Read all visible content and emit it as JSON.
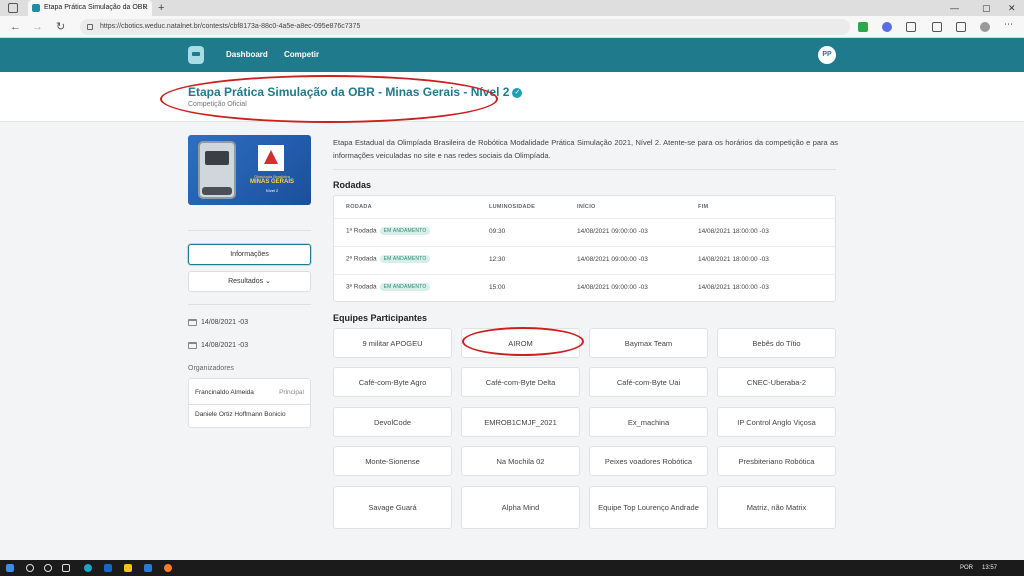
{
  "browser": {
    "tab_title": "Etapa Prática Simulação da OBR",
    "tab_close": "×",
    "new_tab": "+",
    "url": "https://cbotics.weduc.natalnet.br/contests/cbf8173a-88c0-4a5e-a8ec-095e876c7375",
    "back": "←",
    "forward": "→",
    "reload": "↻",
    "minimize": "—",
    "maximize": "▢",
    "close": "✕"
  },
  "appbar": {
    "nav": [
      "Dashboard",
      "Competir"
    ],
    "avatar_initials": "PP"
  },
  "header": {
    "title": "Etapa Prática Simulação da OBR - Minas Gerais - Nível 2",
    "verified_mark": "✓",
    "subtitle": "Competição Oficial"
  },
  "banner": {
    "small_text": "Olimpíada Brasileira",
    "big_text": "MINAS GERAIS",
    "level_text": "Nível 2"
  },
  "sidebar": {
    "info_button": "Informações",
    "results_button": "Resultados",
    "results_chevron": "⌄",
    "dates": [
      "14/08/2021 -03",
      "14/08/2021 -03"
    ],
    "organizers_title": "Organizadores",
    "organizers": [
      {
        "name": "Francinaldo Almeida",
        "role": "Principal"
      },
      {
        "name": "Daniele Ortiz Hoffmann Bonicio",
        "role": ""
      }
    ]
  },
  "main": {
    "description": "Etapa Estadual da Olimpíada Brasileira de Robótica Modalidade Prática Simulação 2021, Nível 2. Atente-se para os horários da competição e para as informações veiculadas no site e nas redes sociais da Olimpíada.",
    "rounds_title": "Rodadas",
    "rounds_headers": [
      "RODADA",
      "LUMINOSIDADE",
      "INÍCIO",
      "FIM"
    ],
    "rounds": [
      {
        "name": "1ª Rodada",
        "status": "EM ANDAMENTO",
        "luminosity": "09:30",
        "start": "14/08/2021 09:00:00 -03",
        "end": "14/08/2021 18:00:00 -03"
      },
      {
        "name": "2ª Rodada",
        "status": "EM ANDAMENTO",
        "luminosity": "12:30",
        "start": "14/08/2021 09:00:00 -03",
        "end": "14/08/2021 18:00:00 -03"
      },
      {
        "name": "3ª Rodada",
        "status": "EM ANDAMENTO",
        "luminosity": "15:00",
        "start": "14/08/2021 09:00:00 -03",
        "end": "14/08/2021 18:00:00 -03"
      }
    ],
    "teams_title": "Equipes Participantes",
    "teams": [
      "9 militar APOGEU",
      "AIROM",
      "Baymax Team",
      "Bebês do Títio",
      "Café-com-Byte Agro",
      "Café-com-Byte Delta",
      "Café-com-Byte Uai",
      "CNEC-Uberaba-2",
      "DevolCode",
      "EMROB1CMJF_2021",
      "Ex_machina",
      "IP Control Anglo Viçosa",
      "Monte-Sionense",
      "Na Mochila 02",
      "Peixes voadores Robótica",
      "Presbiteriano Robótica",
      "Savage Guará",
      "Alpha Mind",
      "Equipe Top Lourenço Andrade",
      "Matriz, não Matrix"
    ]
  },
  "taskbar": {
    "lang": "POR",
    "time": "13:57"
  },
  "colors": {
    "accent": "#1f7a8c",
    "annotation": "#cc1f1f",
    "badge_bg": "#d8efe9",
    "badge_fg": "#2b8a73"
  }
}
